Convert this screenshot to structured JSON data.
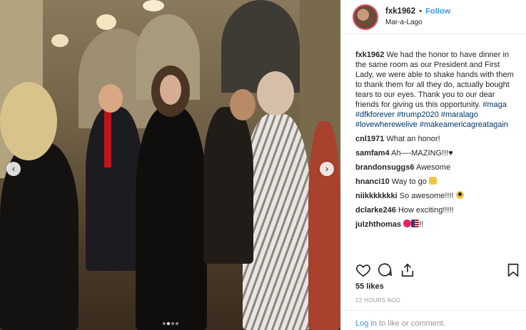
{
  "post": {
    "username": "fxk1962",
    "follow_label": "Follow",
    "separator": "•",
    "location": "Mar-a-Lago",
    "caption": {
      "username": "fxk1962",
      "text": "We had the honor to have dinner in the same room as our President and First Lady, we were able to shake hands with them to thank them for all they do, actually bought tears to our eyes. Thank you to our dear friends for giving us this opportunity.",
      "hashtags": "#maga #dfkforever #trump2020 #maralago #lovewherewelive #makeamericagreatagain"
    },
    "comments": [
      {
        "user": "cnl1971",
        "text": "What an honor!"
      },
      {
        "user": "samfam4",
        "text": "Ah—-MAZING!!!♥"
      },
      {
        "user": "brandonsuggs6",
        "text": "Awesome"
      },
      {
        "user": "hnanci10",
        "text": "Way to go"
      },
      {
        "user": "niikkkkkkki",
        "text": "So awesome!!!!"
      },
      {
        "user": "dclarke246",
        "text": "How exciting!!!!!"
      },
      {
        "user": "julzhthomas",
        "text": "!!"
      }
    ],
    "comment_emojis": {
      "hnanci10": "clapping-hands-emoji",
      "niikkkkkkki": "sunglasses-face-emoji",
      "julzhthomas_1": "red-heart-emoji",
      "julzhthomas_2": "us-flag-emoji"
    },
    "likes": "55 likes",
    "time": "22 HOURS AGO",
    "login_link": "Log in",
    "login_rest": " to like or comment."
  },
  "carousel": {
    "prev_icon": "chevron-left-icon",
    "next_icon": "chevron-right-icon",
    "active_index": 1,
    "count": 4
  },
  "icons": {
    "like": "heart-outline-icon",
    "comment": "comment-bubble-icon",
    "share": "share-icon",
    "save": "bookmark-icon"
  },
  "colors": {
    "link": "#3897f0",
    "hashtag": "#003569",
    "muted": "#999999",
    "text": "#262626",
    "border": "#efefef"
  }
}
